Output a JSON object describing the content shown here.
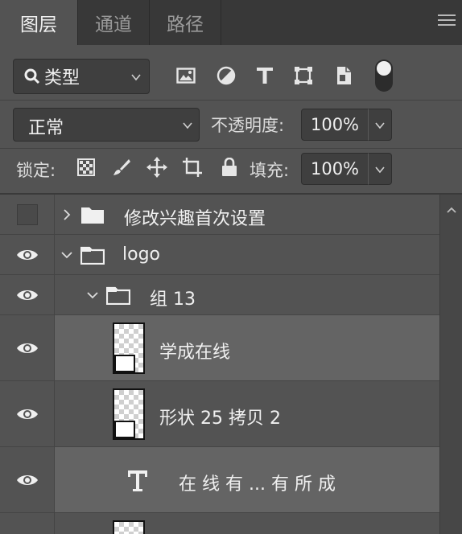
{
  "tabs": [
    {
      "label": "图层"
    },
    {
      "label": "通道"
    },
    {
      "label": "路径"
    }
  ],
  "filter": {
    "kind_label": "类型"
  },
  "blend": {
    "mode": "正常",
    "opacity_label": "不透明度:",
    "opacity_value": "100%"
  },
  "lock": {
    "label": "锁定:",
    "fill_label": "填充:",
    "fill_value": "100%"
  },
  "layers": [
    {
      "name": "修改兴趣首次设置",
      "visible": false,
      "type": "group",
      "expanded": false
    },
    {
      "name": "logo",
      "visible": true,
      "type": "group",
      "expanded": true
    },
    {
      "name": "组 13",
      "visible": true,
      "type": "group",
      "expanded": true
    },
    {
      "name": "学成在线",
      "visible": true,
      "type": "shape"
    },
    {
      "name": "形状 25 拷贝 2",
      "visible": true,
      "type": "shape"
    },
    {
      "name": "在 线 有 ... 有 所 成",
      "visible": true,
      "type": "text"
    }
  ]
}
